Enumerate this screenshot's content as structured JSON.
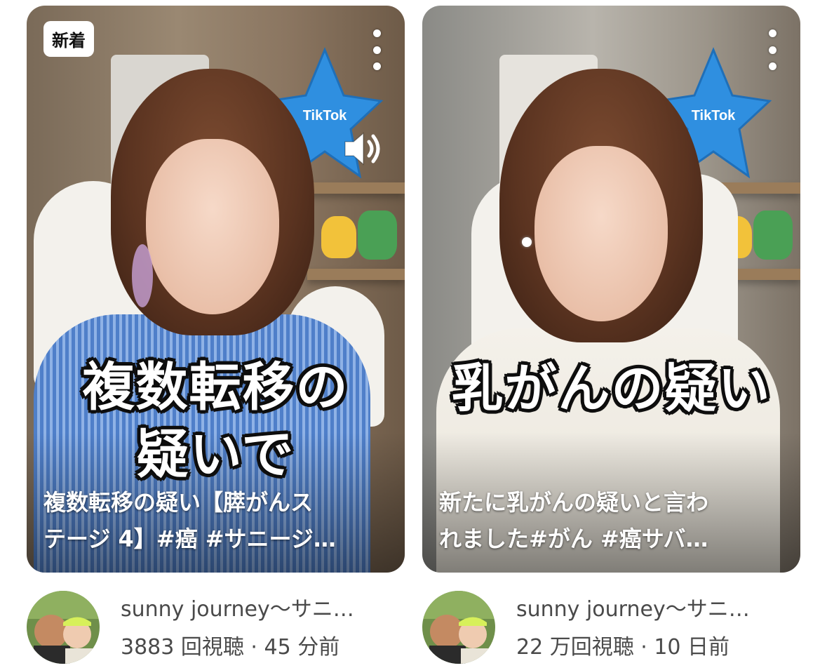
{
  "cards": [
    {
      "badge": "新着",
      "overlay_line1": "複数転移の",
      "overlay_line2": "疑いで",
      "title_line1": "複数転移の疑い【膵がんス",
      "title_line2": "テージ 4】#癌 #サニージ…",
      "channel": "sunny journey～サニ…",
      "stats": "3883 回視聴 · 45 分前",
      "plush_label": "TikTok"
    },
    {
      "overlay_line1": "乳がんの疑い",
      "title_line1": "新たに乳がんの疑いと言わ",
      "title_line2": "れました#がん #癌サバ…",
      "channel": "sunny journey～サニ…",
      "stats": "22 万回視聴 · 10 日前",
      "plush_label": "TikTok"
    }
  ],
  "icons": {
    "more": "more-vertical-icon",
    "sound": "speaker-icon"
  },
  "colors": {
    "text_secondary": "#4a4a4a",
    "badge_bg": "#ffffff",
    "plush_blue": "#2f8fe0"
  }
}
